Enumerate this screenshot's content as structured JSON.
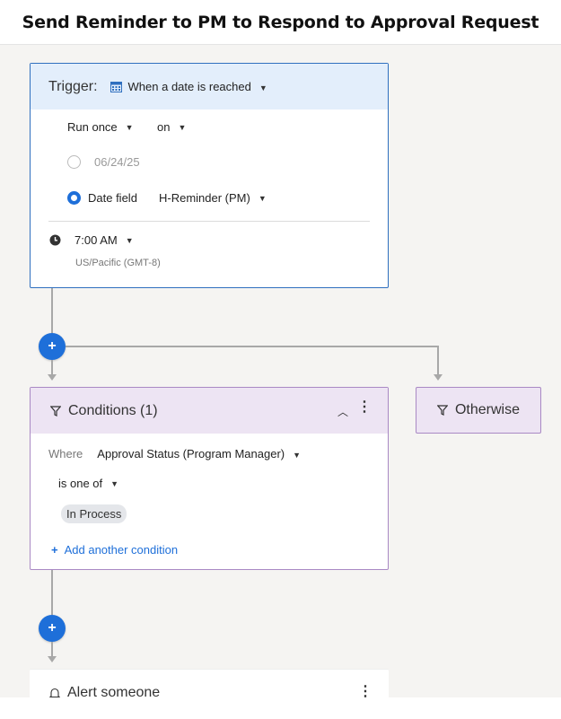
{
  "header": {
    "title": "Send Reminder to PM to Respond to Approval Request"
  },
  "trigger": {
    "label": "Trigger:",
    "type_value": "When a date is reached",
    "frequency": "Run once",
    "on": "on",
    "date_value": "06/24/25",
    "date_field_label": "Date field",
    "date_field_value": "H-Reminder (PM)",
    "time": "7:00 AM",
    "timezone": "US/Pacific (GMT-8)"
  },
  "conditions": {
    "title": "Conditions (1)",
    "where_label": "Where",
    "field": "Approval Status (Program Manager)",
    "operator": "is one of",
    "values": [
      "In Process"
    ],
    "add_label": "Add another condition"
  },
  "otherwise": {
    "title": "Otherwise"
  },
  "alert": {
    "title": "Alert someone"
  },
  "add_step_symbol": "+",
  "colors": {
    "accent": "#1e6fd9",
    "trigger_bg": "#e3eefb",
    "condition_bg": "#ede4f3"
  }
}
